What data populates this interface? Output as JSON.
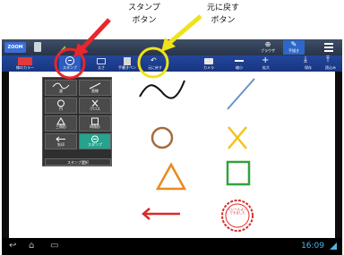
{
  "annotations": {
    "stamp_caption_line1": "スタンプ",
    "stamp_caption_line2": "ボタン",
    "undo_caption_line1": "元に戻す",
    "undo_caption_line2": "ボタン"
  },
  "topbar": {
    "logo_text": "ZOOM",
    "browser_label": "ブラウザ",
    "handwriting_label": "手描き"
  },
  "toolbar": {
    "color_label": "線のカラー",
    "stamp_label": "スタンプ",
    "line_width_label": "太さ",
    "pen_label": "手書きペン",
    "undo_label": "元に戻す",
    "camera_label": "カメラ",
    "minus_label": "縮小",
    "plus_label": "拡大",
    "save_label": "保存",
    "load_label": "読込み"
  },
  "stamp_menu": {
    "items": [
      {
        "label": "波"
      },
      {
        "label": "直線"
      },
      {
        "label": "円"
      },
      {
        "label": "クロス"
      },
      {
        "label": "三角形"
      },
      {
        "label": "四角形"
      },
      {
        "label": "矢印"
      },
      {
        "label": "スタンプ"
      }
    ],
    "footer": "スタンプ選択"
  },
  "canvas": {
    "stamp_text": "たいへんよくできました"
  },
  "status": {
    "clock": "16:09"
  },
  "colors": {
    "toolbar": "#1f3f93",
    "selected_stamp": "#25a38e",
    "clock": "#4fb6e6",
    "red_callout": "#e8262b",
    "yellow_callout": "#f0e21a"
  }
}
